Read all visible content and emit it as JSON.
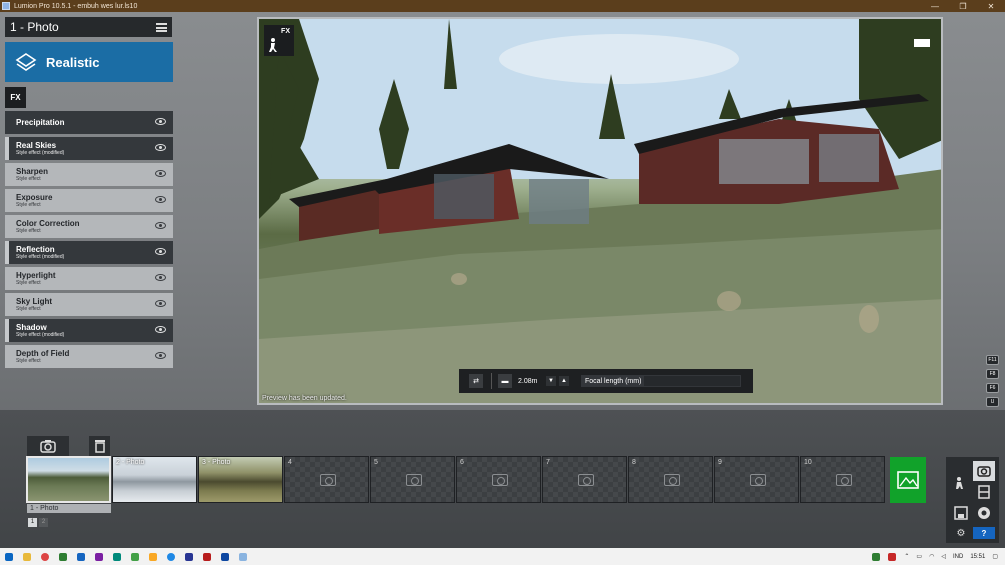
{
  "window": {
    "title": "Lumion Pro 10.5.1  -  embuh wes lur.ls10",
    "controls": [
      "—",
      "❐",
      "✕"
    ]
  },
  "header": {
    "title": "1 - Photo"
  },
  "style_button": {
    "label": "Realistic"
  },
  "fx_tab": {
    "label": "FX"
  },
  "effects": [
    {
      "name": "Precipitation",
      "sub": "",
      "dark": true,
      "mod": false
    },
    {
      "name": "Real Skies",
      "sub": "Style effect (modified)",
      "dark": true,
      "mod": true
    },
    {
      "name": "Sharpen",
      "sub": "Style effect",
      "dark": false,
      "mod": false
    },
    {
      "name": "Exposure",
      "sub": "Style effect",
      "dark": false,
      "mod": false
    },
    {
      "name": "Color Correction",
      "sub": "Style effect",
      "dark": false,
      "mod": false
    },
    {
      "name": "Reflection",
      "sub": "Style effect (modified)",
      "dark": true,
      "mod": true
    },
    {
      "name": "Hyperlight",
      "sub": "Style effect",
      "dark": false,
      "mod": false
    },
    {
      "name": "Sky Light",
      "sub": "Style effect",
      "dark": false,
      "mod": false
    },
    {
      "name": "Shadow",
      "sub": "Style effect (modified)",
      "dark": true,
      "mod": true
    },
    {
      "name": "Depth of Field",
      "sub": "Style effect",
      "dark": false,
      "mod": false
    }
  ],
  "viewport": {
    "fx_badge": "FX",
    "status": "Preview has been updated."
  },
  "camera_toolbar": {
    "height_value": "2.08m",
    "focal_label": "Focal length (mm)"
  },
  "key_hints": [
    "F11",
    "F8",
    "F6",
    "U"
  ],
  "photo_slots": [
    {
      "label": "",
      "filled": true
    },
    {
      "label": "2 - Photo",
      "filled": true
    },
    {
      "label": "3 - Photo",
      "filled": true
    },
    {
      "label": "4",
      "filled": false
    },
    {
      "label": "5",
      "filled": false
    },
    {
      "label": "6",
      "filled": false
    },
    {
      "label": "7",
      "filled": false
    },
    {
      "label": "8",
      "filled": false
    },
    {
      "label": "9",
      "filled": false
    },
    {
      "label": "10",
      "filled": false
    }
  ],
  "selected_slot_label": "1 - Photo",
  "pages": [
    "1",
    "2"
  ],
  "taskbar": {
    "lang": "IND",
    "time": "15:51"
  },
  "colors": {
    "accent": "#1b6da5",
    "render_green": "#11a22a"
  }
}
